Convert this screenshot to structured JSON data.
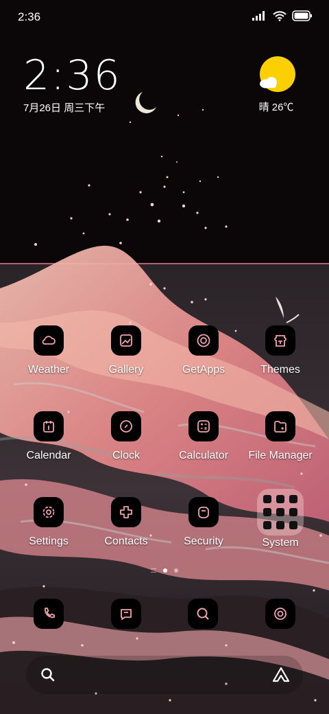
{
  "status_bar": {
    "time": "2:36"
  },
  "clock_widget": {
    "time": "2:36",
    "date": "7月26日 周三下午"
  },
  "weather_widget": {
    "text": "晴 26℃"
  },
  "apps": {
    "weather": "Weather",
    "gallery": "Gallery",
    "getapps": "GetApps",
    "themes": "Themes",
    "calendar": "Calendar",
    "clock": "Clock",
    "calculator": "Calculator",
    "file_manager": "File Manager",
    "settings": "Settings",
    "contacts": "Contacts",
    "security": "Security",
    "system": "System"
  },
  "dock": {
    "items": [
      "phone-icon",
      "messages-icon",
      "browser-icon",
      "camera-icon"
    ]
  },
  "colors": {
    "icon_accent": "#f2a3b0",
    "sky": "#0a0607",
    "moon": "#ebe6d7",
    "sun": "#fcd000"
  }
}
